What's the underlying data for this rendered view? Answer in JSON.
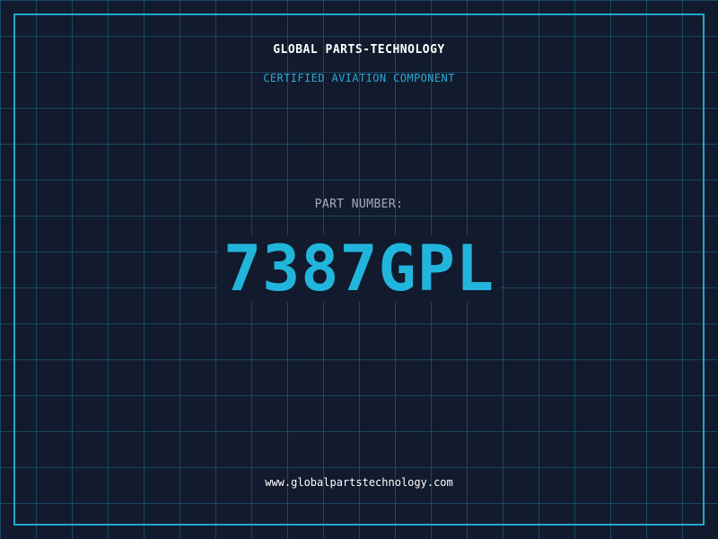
{
  "brand": "GLOBAL PARTS-TECHNOLOGY",
  "subtitle": "CERTIFIED AVIATION COMPONENT",
  "part": {
    "label": "PART NUMBER:",
    "number": "7387GPL"
  },
  "footer": {
    "url": "www.globalpartstechnology.com"
  },
  "colors": {
    "background": "#121a2d",
    "grid": "#1e6e8c",
    "accent": "#22b5dc",
    "frame": "#22a7cc",
    "text": "#ffffff",
    "muted": "#a3acbc"
  }
}
